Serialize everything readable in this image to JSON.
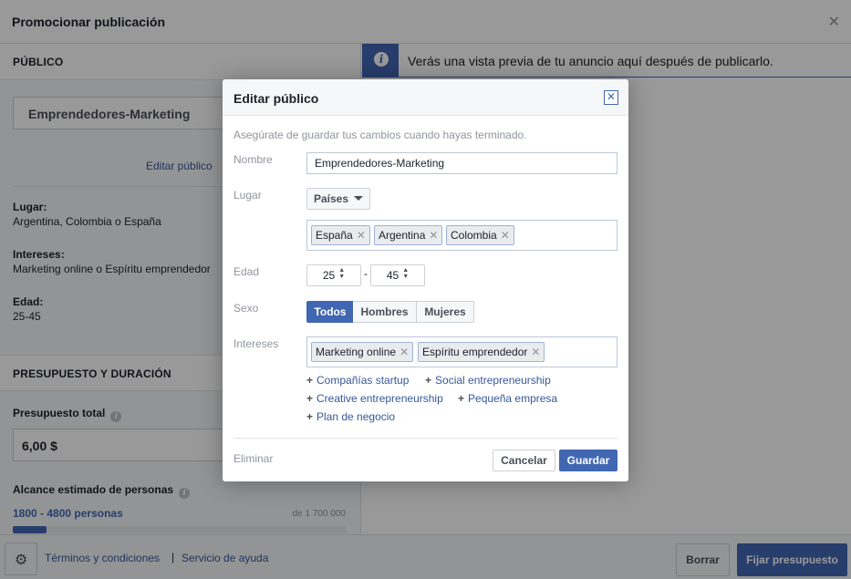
{
  "window": {
    "title": "Promocionar publicación"
  },
  "left": {
    "publico_header": "PÚBLICO",
    "audience_name": "Emprendedores-Marketing",
    "edit_link": "Editar público",
    "lugar_label": "Lugar:",
    "lugar_value": "Argentina, Colombia o España",
    "intereses_label": "Intereses:",
    "intereses_value": "Marketing online o Espíritu emprendedor",
    "edad_label": "Edad:",
    "edad_value": "25-45",
    "presupuesto_header": "PRESUPUESTO Y DURACIÓN",
    "budget_label": "Presupuesto total",
    "budget_value": "6,00 $",
    "reach_label": "Alcance estimado de personas",
    "reach_value": "1800 - 4800 personas",
    "reach_total": "de 1 700 000",
    "reach_fraction": 0.1
  },
  "banner": {
    "text": "Verás una vista previa de tu anuncio aquí después de publicarlo."
  },
  "footer": {
    "terms": "Términos y condiciones",
    "separator": "|",
    "help": "Servicio de ayuda",
    "borrar": "Borrar",
    "fijar": "Fijar presupuesto"
  },
  "dialog": {
    "title": "Editar público",
    "subtitle": "Asegúrate de guardar tus cambios cuando hayas terminado.",
    "nombre_label": "Nombre",
    "nombre_value": "Emprendedores-Marketing",
    "lugar_label": "Lugar",
    "lugar_type": "Países",
    "countries": [
      "España",
      "Argentina",
      "Colombia"
    ],
    "edad_label": "Edad",
    "age_min": "25",
    "age_dash": "-",
    "age_max": "45",
    "sexo_label": "Sexo",
    "sexo_options": [
      "Todos",
      "Hombres",
      "Mujeres"
    ],
    "intereses_label": "Intereses",
    "interests": [
      "Marketing online",
      "Espíritu emprendedor"
    ],
    "suggestions": [
      "Compañías startup",
      "Social entrepreneurship",
      "Creative entrepreneurship",
      "Pequeña empresa",
      "Plan de negocio"
    ],
    "eliminar": "Eliminar",
    "cancel": "Cancelar",
    "save": "Guardar"
  },
  "icons": {
    "close": "close-icon",
    "gear": "gear-icon",
    "info": "info-icon"
  },
  "colors": {
    "accent": "#4267b2",
    "link": "#365899"
  }
}
